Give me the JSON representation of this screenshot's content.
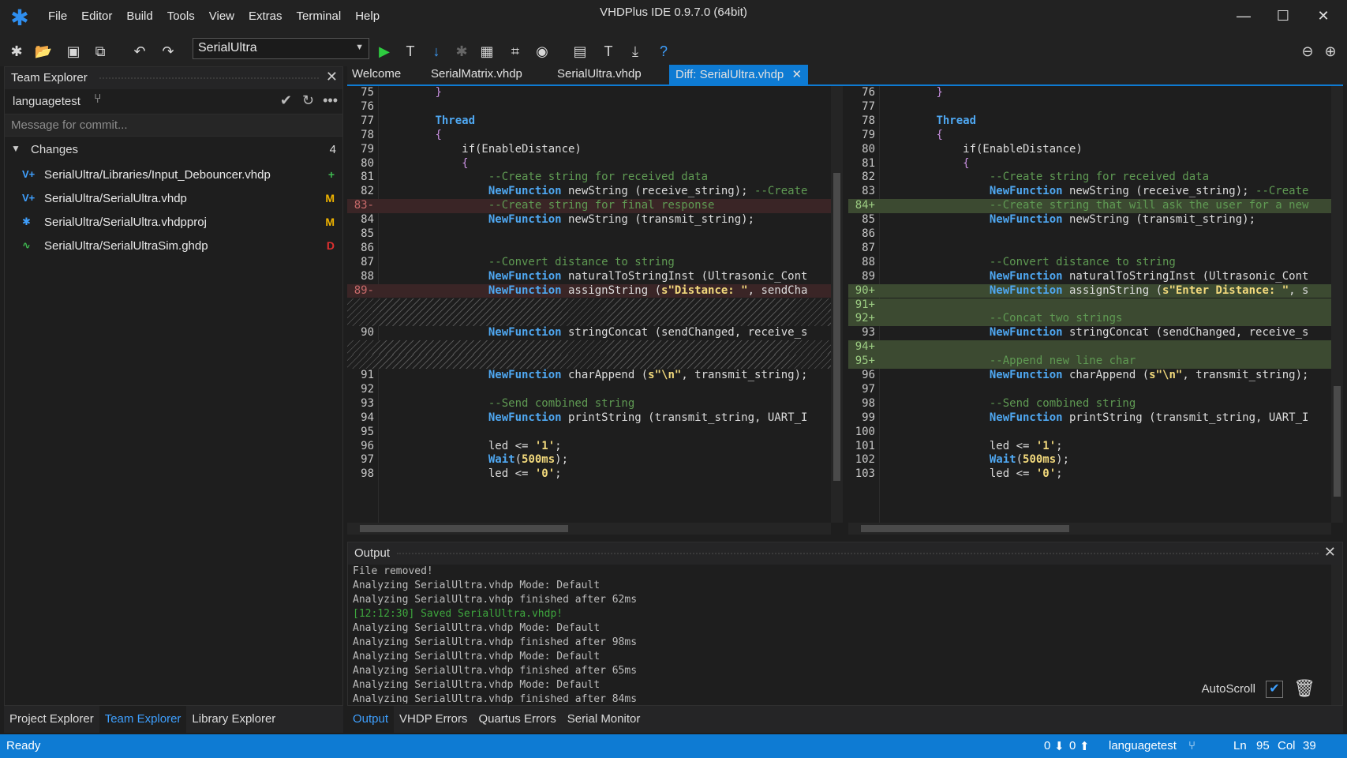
{
  "window": {
    "title": "VHDPlus IDE 0.9.7.0 (64bit)"
  },
  "menu": [
    "File",
    "Editor",
    "Build",
    "Tools",
    "View",
    "Extras",
    "Terminal",
    "Help"
  ],
  "toolbar": {
    "project": "SerialUltra"
  },
  "team_explorer": {
    "title": "Team Explorer",
    "branch": "languagetest",
    "commit_placeholder": "Message for commit...",
    "changes_label": "Changes",
    "changes_count": "4",
    "files": [
      {
        "path": "SerialUltra/Libraries/Input_Debouncer.vhdp",
        "status": "+",
        "status_color": "#3fb950",
        "icon": "vhdp-file-icon",
        "icon_text": "V+"
      },
      {
        "path": "SerialUltra/SerialUltra.vhdp",
        "status": "M",
        "status_color": "#f0b400",
        "icon": "vhdp-file-icon",
        "icon_text": "V+"
      },
      {
        "path": "SerialUltra/SerialUltra.vhdpproj",
        "status": "M",
        "status_color": "#f0b400",
        "icon": "project-file-icon",
        "icon_text": "✱"
      },
      {
        "path": "SerialUltra/SerialUltraSim.ghdp",
        "status": "D",
        "status_color": "#e03030",
        "icon": "simulation-file-icon",
        "icon_text": "∿"
      }
    ]
  },
  "left_tabs": [
    "Project Explorer",
    "Team Explorer",
    "Library Explorer"
  ],
  "editor_tabs": [
    "Welcome",
    "SerialMatrix.vhdp",
    "SerialUltra.vhdp",
    "Diff: SerialUltra.vhdp"
  ],
  "diff_left": [
    {
      "n": "75",
      "k": "n",
      "t": [
        [
          "        ",
          ""
        ],
        [
          "}",
          "pl"
        ]
      ]
    },
    {
      "n": "76",
      "k": "n",
      "t": []
    },
    {
      "n": "77",
      "k": "n",
      "t": [
        [
          "        ",
          ""
        ],
        [
          "Thread",
          "kw"
        ]
      ]
    },
    {
      "n": "78",
      "k": "n",
      "t": [
        [
          "        ",
          ""
        ],
        [
          "{",
          "pl"
        ]
      ]
    },
    {
      "n": "79",
      "k": "n",
      "t": [
        [
          "            if(EnableDistance)",
          ""
        ]
      ]
    },
    {
      "n": "80",
      "k": "n",
      "t": [
        [
          "            ",
          ""
        ],
        [
          "{",
          "pl"
        ]
      ]
    },
    {
      "n": "81",
      "k": "n",
      "t": [
        [
          "                ",
          ""
        ],
        [
          "--Create string for received data",
          "cm"
        ]
      ]
    },
    {
      "n": "82",
      "k": "n",
      "t": [
        [
          "                ",
          ""
        ],
        [
          "NewFunction",
          "kw"
        ],
        [
          " newString (receive_string); ",
          ""
        ],
        [
          "--Create",
          "cm"
        ]
      ]
    },
    {
      "n": "83-",
      "k": "r",
      "t": [
        [
          "                ",
          ""
        ],
        [
          "--Create string for final response",
          "cm"
        ]
      ]
    },
    {
      "n": "84",
      "k": "n",
      "t": [
        [
          "                ",
          ""
        ],
        [
          "NewFunction",
          "kw"
        ],
        [
          " newString (transmit_string);",
          ""
        ]
      ]
    },
    {
      "n": "85",
      "k": "n",
      "t": []
    },
    {
      "n": "86",
      "k": "n",
      "t": []
    },
    {
      "n": "87",
      "k": "n",
      "t": [
        [
          "                ",
          ""
        ],
        [
          "--Convert distance to string",
          "cm"
        ]
      ]
    },
    {
      "n": "88",
      "k": "n",
      "t": [
        [
          "                ",
          ""
        ],
        [
          "NewFunction",
          "kw"
        ],
        [
          " naturalToStringInst (Ultrasonic_Cont",
          ""
        ]
      ]
    },
    {
      "n": "89-",
      "k": "r",
      "t": [
        [
          "                ",
          ""
        ],
        [
          "NewFunction",
          "kw"
        ],
        [
          " assignString (",
          ""
        ],
        [
          "s\"Distance: \"",
          "st2"
        ],
        [
          ", sendCha",
          ""
        ]
      ]
    },
    {
      "n": "",
      "k": "h",
      "t": []
    },
    {
      "n": "",
      "k": "h",
      "t": []
    },
    {
      "n": "90",
      "k": "n",
      "t": [
        [
          "                ",
          ""
        ],
        [
          "NewFunction",
          "kw"
        ],
        [
          " stringConcat (sendChanged, receive_s",
          ""
        ]
      ]
    },
    {
      "n": "",
      "k": "h",
      "t": []
    },
    {
      "n": "",
      "k": "h",
      "t": []
    },
    {
      "n": "91",
      "k": "n",
      "t": [
        [
          "                ",
          ""
        ],
        [
          "NewFunction",
          "kw"
        ],
        [
          " charAppend (",
          ""
        ],
        [
          "s\"\\n\"",
          "st2"
        ],
        [
          ", transmit_string);",
          ""
        ]
      ]
    },
    {
      "n": "92",
      "k": "n",
      "t": []
    },
    {
      "n": "93",
      "k": "n",
      "t": [
        [
          "                ",
          ""
        ],
        [
          "--Send combined string",
          "cm"
        ]
      ]
    },
    {
      "n": "94",
      "k": "n",
      "t": [
        [
          "                ",
          ""
        ],
        [
          "NewFunction",
          "kw"
        ],
        [
          " printString (transmit_string, UART_I",
          ""
        ]
      ]
    },
    {
      "n": "95",
      "k": "n",
      "t": []
    },
    {
      "n": "96",
      "k": "n",
      "t": [
        [
          "                led <= ",
          ""
        ],
        [
          "'1'",
          "st2"
        ],
        [
          ";",
          ""
        ]
      ]
    },
    {
      "n": "97",
      "k": "n",
      "t": [
        [
          "                ",
          ""
        ],
        [
          "Wait",
          "kw"
        ],
        [
          "(",
          ""
        ],
        [
          "500ms",
          "st2"
        ],
        [
          ");",
          ""
        ]
      ]
    },
    {
      "n": "98",
      "k": "n",
      "t": [
        [
          "                led <= ",
          ""
        ],
        [
          "'0'",
          "st2"
        ],
        [
          ";",
          ""
        ]
      ]
    }
  ],
  "diff_right": [
    {
      "n": "76",
      "k": "n",
      "t": [
        [
          "        ",
          ""
        ],
        [
          "}",
          "pl"
        ]
      ]
    },
    {
      "n": "77",
      "k": "n",
      "t": []
    },
    {
      "n": "78",
      "k": "n",
      "t": [
        [
          "        ",
          ""
        ],
        [
          "Thread",
          "kw"
        ]
      ]
    },
    {
      "n": "79",
      "k": "n",
      "t": [
        [
          "        ",
          ""
        ],
        [
          "{",
          "pl"
        ]
      ]
    },
    {
      "n": "80",
      "k": "n",
      "t": [
        [
          "            if(EnableDistance)",
          ""
        ]
      ]
    },
    {
      "n": "81",
      "k": "n",
      "t": [
        [
          "            ",
          ""
        ],
        [
          "{",
          "pl"
        ]
      ]
    },
    {
      "n": "82",
      "k": "n",
      "t": [
        [
          "                ",
          ""
        ],
        [
          "--Create string for received data",
          "cm"
        ]
      ]
    },
    {
      "n": "83",
      "k": "n",
      "t": [
        [
          "                ",
          ""
        ],
        [
          "NewFunction",
          "kw"
        ],
        [
          " newString (receive_string); ",
          ""
        ],
        [
          "--Create",
          "cm"
        ]
      ]
    },
    {
      "n": "84+",
      "k": "a",
      "t": [
        [
          "                ",
          ""
        ],
        [
          "--Create string that will ask the user for a new",
          "cm"
        ]
      ]
    },
    {
      "n": "85",
      "k": "n",
      "t": [
        [
          "                ",
          ""
        ],
        [
          "NewFunction",
          "kw"
        ],
        [
          " newString (transmit_string);",
          ""
        ]
      ]
    },
    {
      "n": "86",
      "k": "n",
      "t": []
    },
    {
      "n": "87",
      "k": "n",
      "t": []
    },
    {
      "n": "88",
      "k": "n",
      "t": [
        [
          "                ",
          ""
        ],
        [
          "--Convert distance to string",
          "cm"
        ]
      ]
    },
    {
      "n": "89",
      "k": "n",
      "t": [
        [
          "                ",
          ""
        ],
        [
          "NewFunction",
          "kw"
        ],
        [
          " naturalToStringInst (Ultrasonic_Cont",
          ""
        ]
      ]
    },
    {
      "n": "90+",
      "k": "a",
      "t": [
        [
          "                ",
          ""
        ],
        [
          "NewFunction",
          "kw"
        ],
        [
          " assignString (",
          ""
        ],
        [
          "s\"Enter Distance: \"",
          "st2"
        ],
        [
          ", s",
          ""
        ]
      ]
    },
    {
      "n": "91+",
      "k": "a",
      "t": []
    },
    {
      "n": "92+",
      "k": "a",
      "t": [
        [
          "                ",
          ""
        ],
        [
          "--Concat two strings",
          "cm"
        ]
      ]
    },
    {
      "n": "93",
      "k": "n",
      "t": [
        [
          "                ",
          ""
        ],
        [
          "NewFunction",
          "kw"
        ],
        [
          " stringConcat (sendChanged, receive_s",
          ""
        ]
      ]
    },
    {
      "n": "94+",
      "k": "a",
      "t": []
    },
    {
      "n": "95+",
      "k": "a",
      "t": [
        [
          "                ",
          ""
        ],
        [
          "--Append new line char",
          "cm"
        ]
      ]
    },
    {
      "n": "96",
      "k": "n",
      "t": [
        [
          "                ",
          ""
        ],
        [
          "NewFunction",
          "kw"
        ],
        [
          " charAppend (",
          ""
        ],
        [
          "s\"\\n\"",
          "st2"
        ],
        [
          ", transmit_string);",
          ""
        ]
      ]
    },
    {
      "n": "97",
      "k": "n",
      "t": []
    },
    {
      "n": "98",
      "k": "n",
      "t": [
        [
          "                ",
          ""
        ],
        [
          "--Send combined string",
          "cm"
        ]
      ]
    },
    {
      "n": "99",
      "k": "n",
      "t": [
        [
          "                ",
          ""
        ],
        [
          "NewFunction",
          "kw"
        ],
        [
          " printString (transmit_string, UART_I",
          ""
        ]
      ]
    },
    {
      "n": "100",
      "k": "n",
      "t": []
    },
    {
      "n": "101",
      "k": "n",
      "t": [
        [
          "                led <= ",
          ""
        ],
        [
          "'1'",
          "st2"
        ],
        [
          ";",
          ""
        ]
      ]
    },
    {
      "n": "102",
      "k": "n",
      "t": [
        [
          "                ",
          ""
        ],
        [
          "Wait",
          "kw"
        ],
        [
          "(",
          ""
        ],
        [
          "500ms",
          "st2"
        ],
        [
          ");",
          ""
        ]
      ]
    },
    {
      "n": "103",
      "k": "n",
      "t": [
        [
          "                led <= ",
          ""
        ],
        [
          "'0'",
          "st2"
        ],
        [
          ";",
          ""
        ]
      ]
    }
  ],
  "output": {
    "title": "Output",
    "lines": [
      {
        "text": "File removed!",
        "ok": false
      },
      {
        "text": "Analyzing SerialUltra.vhdp Mode: Default",
        "ok": false
      },
      {
        "text": "Analyzing SerialUltra.vhdp finished after 62ms",
        "ok": false
      },
      {
        "text": "[12:12:30] Saved SerialUltra.vhdp!",
        "ok": true
      },
      {
        "text": "Analyzing SerialUltra.vhdp Mode: Default",
        "ok": false
      },
      {
        "text": "Analyzing SerialUltra.vhdp finished after 98ms",
        "ok": false
      },
      {
        "text": "Analyzing SerialUltra.vhdp Mode: Default",
        "ok": false
      },
      {
        "text": "Analyzing SerialUltra.vhdp finished after 65ms",
        "ok": false
      },
      {
        "text": "Analyzing SerialUltra.vhdp Mode: Default",
        "ok": false
      },
      {
        "text": "Analyzing SerialUltra.vhdp finished after 84ms",
        "ok": false
      }
    ],
    "autoscroll_label": "AutoScroll",
    "autoscroll_checked": true
  },
  "output_tabs": [
    "Output",
    "VHDP Errors",
    "Quartus Errors",
    "Serial Monitor"
  ],
  "status": {
    "text": "Ready",
    "incoming": "0",
    "outgoing": "0",
    "branch": "languagetest",
    "ln_label": "Ln",
    "ln": "95",
    "col_label": "Col",
    "col": "39"
  }
}
